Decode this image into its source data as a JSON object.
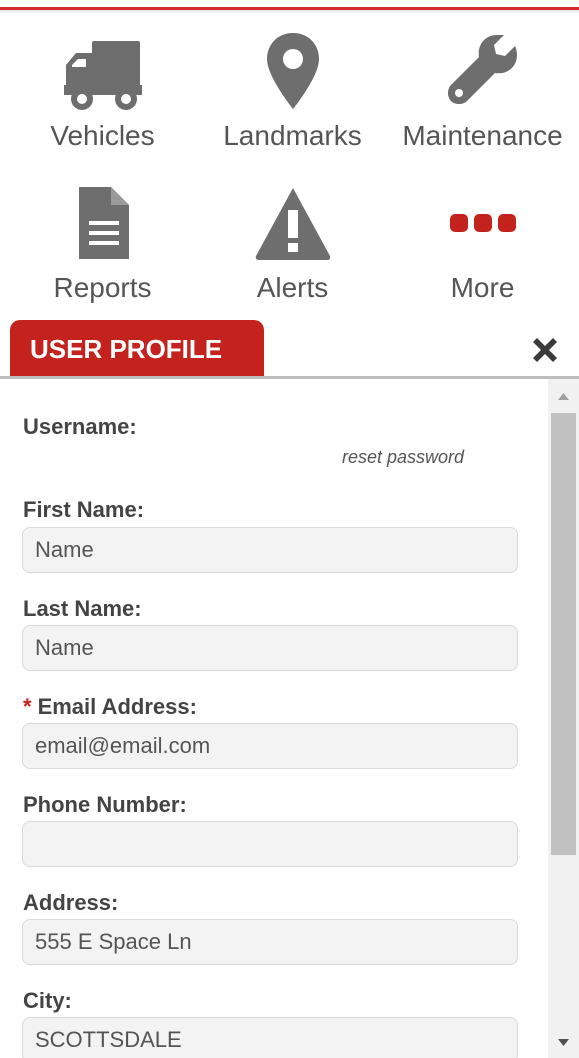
{
  "nav": {
    "items": [
      {
        "label": "Vehicles",
        "icon": "truck-icon"
      },
      {
        "label": "Landmarks",
        "icon": "map-pin-icon"
      },
      {
        "label": "Maintenance",
        "icon": "wrench-icon"
      },
      {
        "label": "Reports",
        "icon": "document-icon"
      },
      {
        "label": "Alerts",
        "icon": "warning-triangle-icon"
      },
      {
        "label": "More",
        "icon": "more-dots-icon"
      }
    ]
  },
  "panel": {
    "tab_label": "USER PROFILE",
    "close_icon": "close-icon"
  },
  "form": {
    "username_label": "Username:",
    "reset_password": "reset password",
    "first_name": {
      "label": "First Name:",
      "value": "Name"
    },
    "last_name": {
      "label": "Last Name:",
      "value": "Name"
    },
    "email": {
      "required_mark": "*",
      "label": "Email Address:",
      "value": "email@email.com"
    },
    "phone": {
      "label": "Phone Number:",
      "value": ""
    },
    "address": {
      "label": "Address:",
      "value": "555 E Space Ln"
    },
    "city": {
      "label": "City:",
      "value": "SCOTTSDALE"
    }
  },
  "colors": {
    "accent": "#c4221d",
    "top_bar": "#d42a2a",
    "icon_gray": "#6e6e6e",
    "label_gray": "#555555",
    "input_bg": "#f3f3f3"
  }
}
